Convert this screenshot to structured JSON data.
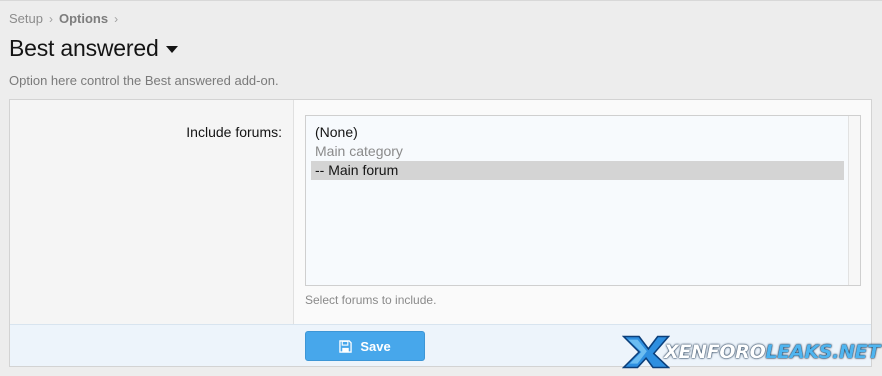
{
  "breadcrumb": [
    {
      "label": "Setup"
    },
    {
      "label": "Options"
    }
  ],
  "breadcrumb_separator": "›",
  "page": {
    "title": "Best answered",
    "description": "Option here control the Best answered add-on."
  },
  "field": {
    "label": "Include forums:",
    "options": [
      {
        "label": "(None)",
        "type": "option",
        "selected": false
      },
      {
        "label": "Main category",
        "type": "group",
        "selected": false
      },
      {
        "label": "-- Main forum",
        "type": "option",
        "selected": true
      }
    ],
    "explain": "Select forums to include."
  },
  "actions": {
    "save_label": "Save",
    "save_icon": "floppy-disk-icon"
  },
  "watermark": {
    "part1": "XENFORO",
    "part2": "LEAKS.NET"
  },
  "colors": {
    "accent": "#47a7eb",
    "selection": "#d4d4d4",
    "footer_bg": "#edf4fb"
  }
}
